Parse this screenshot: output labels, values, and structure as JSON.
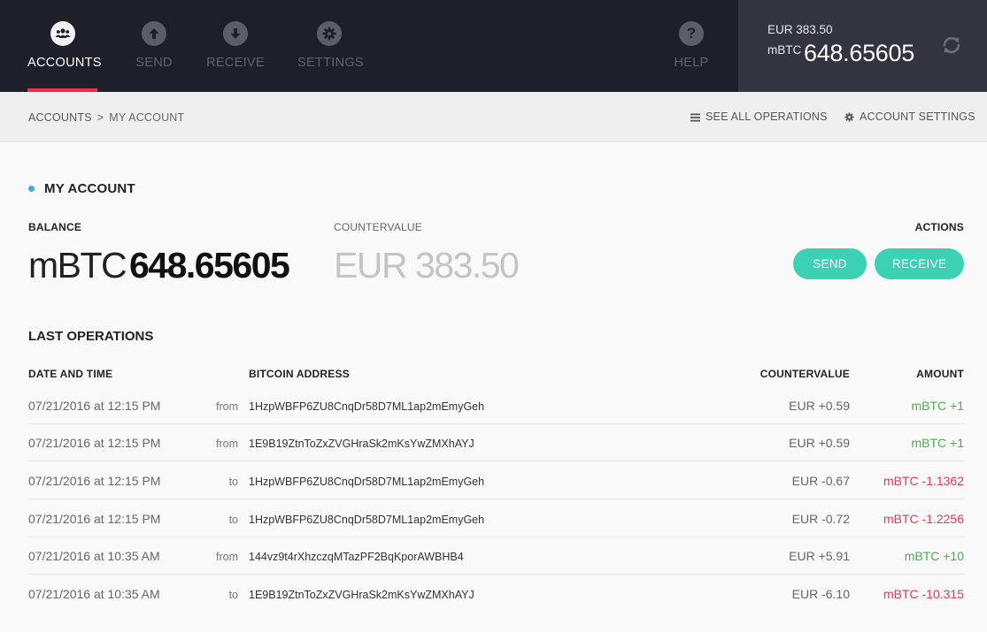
{
  "nav": {
    "items": [
      {
        "label": "ACCOUNTS",
        "icon": "users-icon",
        "active": true
      },
      {
        "label": "SEND",
        "icon": "arrow-up-icon",
        "active": false
      },
      {
        "label": "RECEIVE",
        "icon": "arrow-down-icon",
        "active": false
      },
      {
        "label": "SETTINGS",
        "icon": "gear-icon",
        "active": false
      }
    ],
    "help": {
      "label": "HELP",
      "icon": "question-icon"
    }
  },
  "header_balance": {
    "fiat": "EUR 383.50",
    "unit": "mBTC",
    "value": "648.65605",
    "refresh_icon": "refresh-icon"
  },
  "breadcrumb": {
    "root": "ACCOUNTS",
    "separator": ">",
    "current": "MY ACCOUNT",
    "see_all": "SEE ALL OPERATIONS",
    "see_all_icon": "list-icon",
    "settings": "ACCOUNT SETTINGS",
    "settings_icon": "gear-icon"
  },
  "account": {
    "title": "MY ACCOUNT",
    "dot_color": "#3faed8",
    "balance_label": "BALANCE",
    "balance_unit": "mBTC",
    "balance_value": "648.65605",
    "countervalue_label": "COUNTERVALUE",
    "countervalue": "EUR 383.50",
    "actions_label": "ACTIONS",
    "send_label": "SEND",
    "receive_label": "RECEIVE",
    "button_color": "#3bd1b5"
  },
  "operations": {
    "title": "LAST OPERATIONS",
    "headers": {
      "date": "DATE AND TIME",
      "address": "BITCOIN ADDRESS",
      "countervalue": "COUNTERVALUE",
      "amount": "AMOUNT"
    },
    "rows": [
      {
        "date": "07/21/2016 at 12:15 PM",
        "direction": "from",
        "address": "1HzpWBFP6ZU8CnqDr58D7ML1ap2mEmyGeh",
        "countervalue": "EUR +0.59",
        "amount": "mBTC +1",
        "positive": true
      },
      {
        "date": "07/21/2016 at 12:15 PM",
        "direction": "from",
        "address": "1E9B19ZtnToZxZVGHraSk2mKsYwZMXhAYJ",
        "countervalue": "EUR +0.59",
        "amount": "mBTC +1",
        "positive": true
      },
      {
        "date": "07/21/2016 at 12:15 PM",
        "direction": "to",
        "address": "1HzpWBFP6ZU8CnqDr58D7ML1ap2mEmyGeh",
        "countervalue": "EUR -0.67",
        "amount": "mBTC -1.1362",
        "positive": false
      },
      {
        "date": "07/21/2016 at 12:15 PM",
        "direction": "to",
        "address": "1HzpWBFP6ZU8CnqDr58D7ML1ap2mEmyGeh",
        "countervalue": "EUR -0.72",
        "amount": "mBTC -1.2256",
        "positive": false
      },
      {
        "date": "07/21/2016 at 10:35 AM",
        "direction": "from",
        "address": "144vz9t4rXhzczqMTazPF2BqKporAWBHB4",
        "countervalue": "EUR +5.91",
        "amount": "mBTC +10",
        "positive": true
      },
      {
        "date": "07/21/2016 at 10:35 AM",
        "direction": "to",
        "address": "1E9B19ZtnToZxZVGHraSk2mKsYwZMXhAYJ",
        "countervalue": "EUR -6.10",
        "amount": "mBTC -10.315",
        "positive": false
      }
    ]
  },
  "colors": {
    "nav_bg": "#1d2028",
    "balance_panel_bg": "#32353f",
    "active_underline": "#ea2e49",
    "positive": "#4caf50",
    "negative": "#e8374e"
  }
}
